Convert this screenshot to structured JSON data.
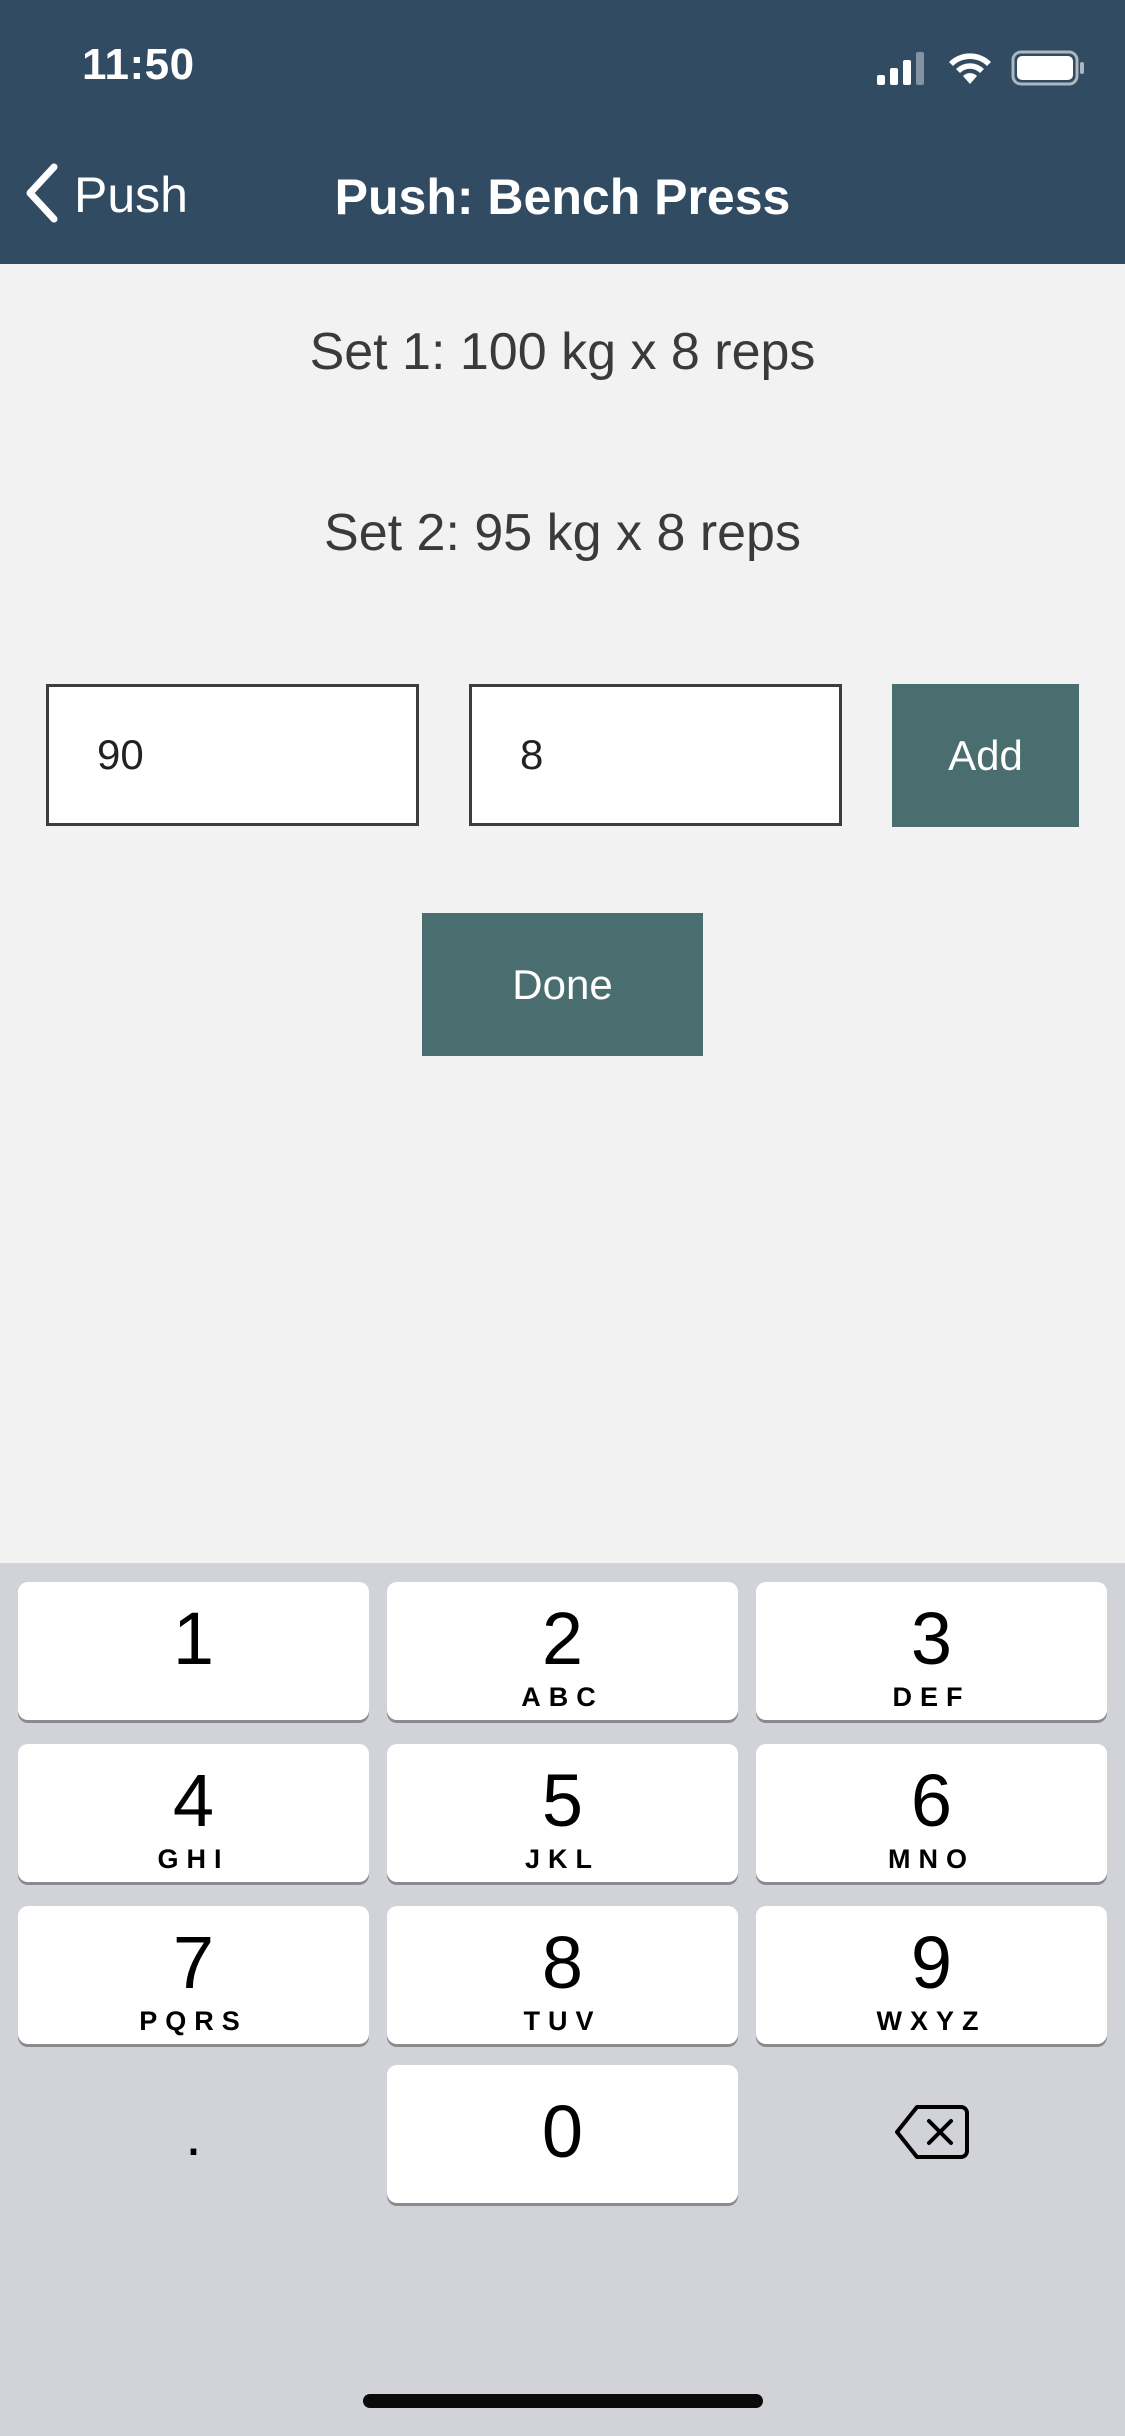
{
  "status": {
    "time": "11:50",
    "icons": [
      "signal-icon",
      "wifi-icon",
      "battery-icon"
    ]
  },
  "nav": {
    "back_label": "Push",
    "title": "Push: Bench Press"
  },
  "sets": [
    {
      "label": "Set 1: 100 kg x 8 reps"
    },
    {
      "label": "Set 2: 95 kg x 8 reps"
    }
  ],
  "form": {
    "weight_value": "90",
    "reps_value": "8",
    "add_label": "Add",
    "done_label": "Done"
  },
  "keyboard": {
    "keys": [
      {
        "digit": "1",
        "letters": ""
      },
      {
        "digit": "2",
        "letters": "ABC"
      },
      {
        "digit": "3",
        "letters": "DEF"
      },
      {
        "digit": "4",
        "letters": "GHI"
      },
      {
        "digit": "5",
        "letters": "JKL"
      },
      {
        "digit": "6",
        "letters": "MNO"
      },
      {
        "digit": "7",
        "letters": "PQRS"
      },
      {
        "digit": "8",
        "letters": "TUV"
      },
      {
        "digit": "9",
        "letters": "WXYZ"
      },
      {
        "digit": "0",
        "letters": ""
      }
    ],
    "decimal": ".",
    "delete_icon": "backspace-icon"
  },
  "colors": {
    "header_bg": "#314b63",
    "accent_button": "#4a6e70",
    "content_bg": "#f2f2f2",
    "keyboard_bg": "#d1d3d9"
  }
}
